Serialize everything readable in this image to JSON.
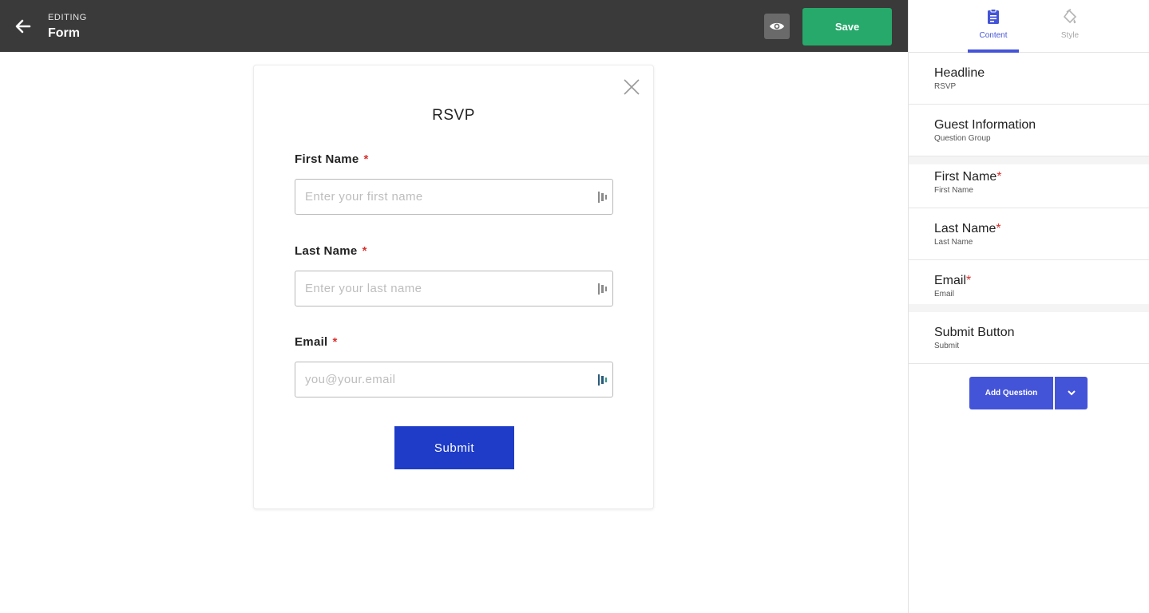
{
  "header": {
    "editing_label": "EDITING",
    "title": "Form",
    "save_label": "Save"
  },
  "form": {
    "headline": "RSVP",
    "fields": [
      {
        "label": "First Name",
        "required_mark": "*",
        "placeholder": "Enter your first name"
      },
      {
        "label": "Last Name",
        "required_mark": "*",
        "placeholder": "Enter your last name"
      },
      {
        "label": "Email",
        "required_mark": "*",
        "placeholder": "you@your.email"
      }
    ],
    "submit_label": "Submit"
  },
  "panel": {
    "tabs": [
      {
        "label": "Content",
        "icon": "clipboard-icon",
        "active": true
      },
      {
        "label": "Style",
        "icon": "paint-bucket-icon",
        "active": false
      }
    ],
    "items": [
      {
        "title": "Headline",
        "subtitle": "RSVP",
        "required": ""
      },
      {
        "title": "Guest Information",
        "subtitle": "Question Group",
        "required": ""
      },
      {
        "title": "First Name",
        "subtitle": "First Name",
        "required": "*"
      },
      {
        "title": "Last Name",
        "subtitle": "Last Name",
        "required": "*"
      },
      {
        "title": "Email",
        "subtitle": "Email",
        "required": "*"
      },
      {
        "title": "Submit Button",
        "subtitle": "Submit",
        "required": ""
      }
    ],
    "add_question_label": "Add Question"
  },
  "colors": {
    "topbar": "#3a3a3a",
    "save": "#26a96a",
    "accent": "#4454d8",
    "submit": "#1e3cc8",
    "required": "#d9322f"
  }
}
